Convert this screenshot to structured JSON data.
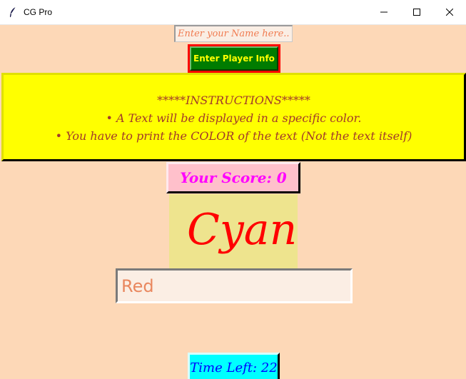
{
  "window": {
    "title": "CG Pro",
    "app_icon": "feather-icon",
    "controls": [
      "minimize-icon",
      "maximize-icon",
      "close-icon"
    ]
  },
  "player": {
    "name_placeholder": "Enter your Name here...",
    "name_value": "",
    "button_label": "Enter Player Info"
  },
  "instructions": {
    "heading": "*****INSTRUCTIONS*****",
    "line1": "• A Text will be displayed in a specific color.",
    "line2": "• You have to print the COLOR of the text (Not the text itself)"
  },
  "score": {
    "label": "Your Score: 0"
  },
  "challenge": {
    "word": "Cyan",
    "word_color": "#ff0000"
  },
  "answer": {
    "value": "Red"
  },
  "timer": {
    "label": "Time Left: 22"
  },
  "colors": {
    "background": "#fdd8b7",
    "instructions_bg": "#ffff00",
    "score_bg": "#ffc0cb",
    "word_bg": "#eee48e",
    "timer_bg": "#00ffff",
    "button_bg": "#007c00",
    "button_border": "#ff0000"
  }
}
